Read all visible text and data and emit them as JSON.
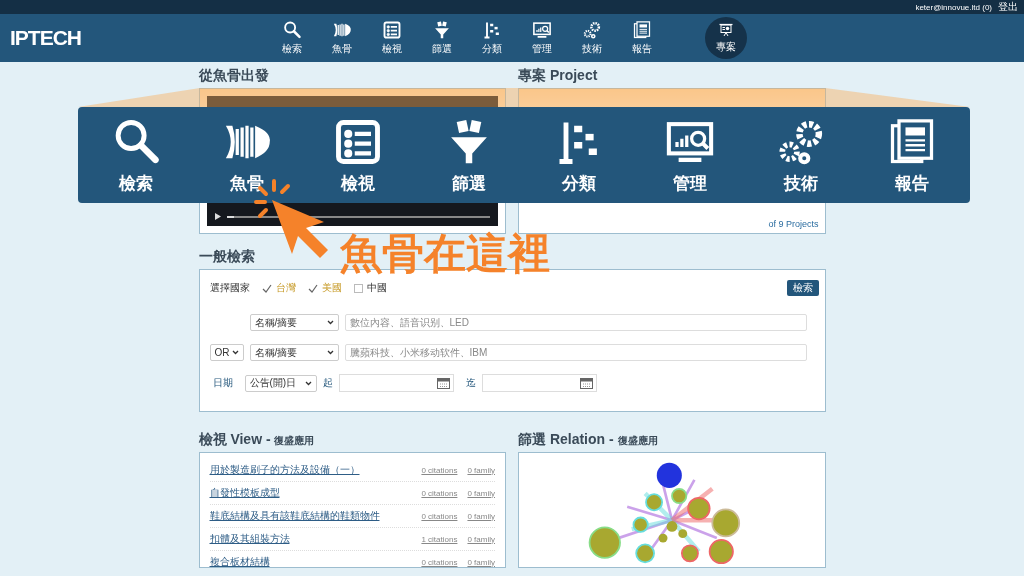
{
  "top_bar": {
    "user": "keter@innovue.ltd (0)",
    "logout": "登出"
  },
  "header": {
    "logo": "IPTECH",
    "nav": [
      {
        "label": "檢索",
        "selected": false
      },
      {
        "label": "魚骨",
        "selected": false
      },
      {
        "label": "檢視",
        "selected": false
      },
      {
        "label": "篩選",
        "selected": false
      },
      {
        "label": "分類",
        "selected": false
      },
      {
        "label": "管理",
        "selected": false
      },
      {
        "label": "技術",
        "selected": false
      },
      {
        "label": "報告",
        "selected": false
      },
      {
        "label": "專案",
        "selected": true
      }
    ]
  },
  "video_section": {
    "title": "從魚骨出發",
    "progress": {
      "level": 0.03
    }
  },
  "project_section": {
    "title_zh": "專案",
    "title_en": "Project",
    "footer": "of 9 Projects"
  },
  "search_section": {
    "title": "一般檢索",
    "country_label": "選擇國家",
    "countries": [
      {
        "label": "台灣",
        "checked": true
      },
      {
        "label": "美國",
        "checked": true
      },
      {
        "label": "中國",
        "checked": false
      }
    ],
    "search_button": "檢索",
    "rows": [
      {
        "field": "名稱/摘要",
        "placeholder": "數位內容、語音识别、LED"
      },
      {
        "operator": "OR",
        "field": "名稱/摘要",
        "placeholder": "騰蘋科技、小米移动软件、IBM"
      }
    ],
    "date": {
      "label": "日期",
      "type": "公告(開)日",
      "from_label": "起",
      "to_label": "迄"
    }
  },
  "view_section": {
    "title": "檢視 View -",
    "subtitle": "復盛應用",
    "rows": [
      {
        "title": "用於製造刷子的方法及設備（一）",
        "citations": "0 citations",
        "family": "0 family"
      },
      {
        "title": "自發性模板成型",
        "citations": "0 citations",
        "family": "0 family"
      },
      {
        "title": "鞋底結構及具有該鞋底結構的鞋類物件",
        "citations": "0 citations",
        "family": "0 family"
      },
      {
        "title": "扣體及其組裝方法",
        "citations": "1 citations",
        "family": "0 family"
      },
      {
        "title": "複合板材結構",
        "citations": "0 citations",
        "family": "0 family"
      }
    ]
  },
  "relation_section": {
    "title": "篩選 Relation -",
    "subtitle": "復盛應用"
  },
  "callout": {
    "menu": [
      "檢索",
      "魚骨",
      "檢視",
      "篩選",
      "分類",
      "管理",
      "技術",
      "報告"
    ],
    "text": "魚骨在這裡"
  }
}
